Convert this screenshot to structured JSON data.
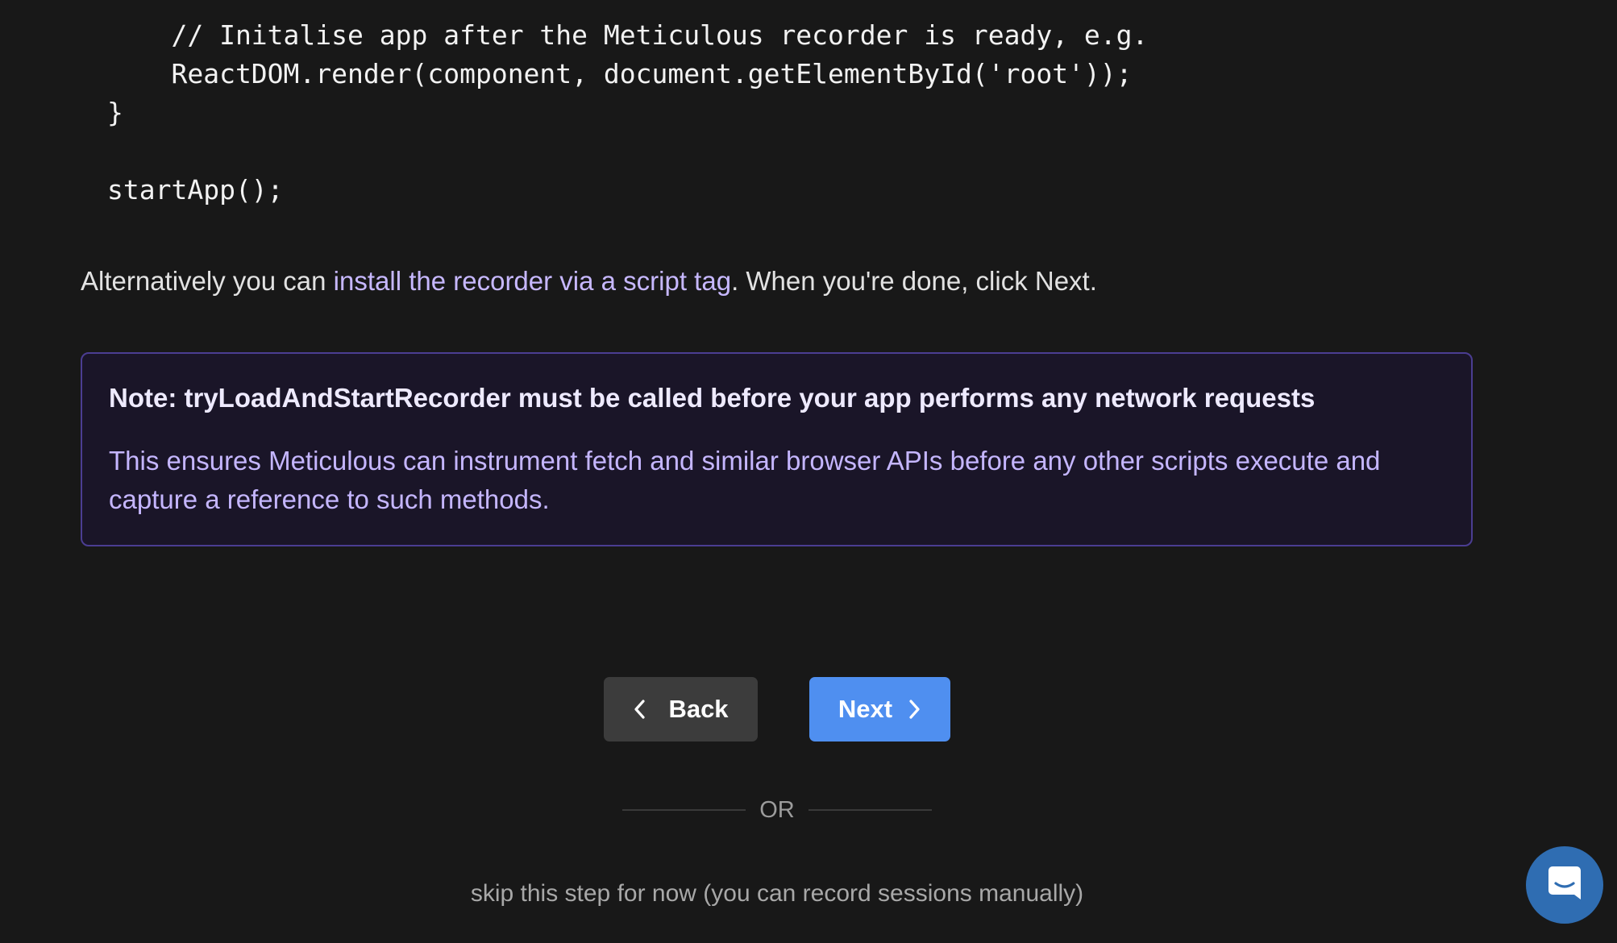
{
  "code": {
    "lines": [
      "    // Initalise app after the Meticulous recorder is ready, e.g.",
      "    ReactDOM.render(component, document.getElementById('root'));",
      "}",
      "",
      "startApp();"
    ]
  },
  "intro": {
    "prefix": "Alternatively you can ",
    "link": "install the recorder via a script tag",
    "suffix": ". When you're done, click Next."
  },
  "note": {
    "title": "Note: tryLoadAndStartRecorder must be called before your app performs any network requests",
    "body": "This ensures Meticulous can instrument fetch and similar browser APIs before any other scripts execute and capture a reference to such methods."
  },
  "buttons": {
    "back_label": "Back",
    "next_label": "Next"
  },
  "divider": {
    "label": "OR"
  },
  "skip": {
    "label": "skip this step for now (you can record sessions manually)"
  },
  "icons": {
    "back": "chevron-left-icon",
    "next": "chevron-right-icon",
    "chat": "chat-icon"
  },
  "colors": {
    "background": "#181818",
    "link": "#c7b8ff",
    "note_border": "#4b3d92",
    "note_background": "#1a1528",
    "next_button": "#4f8ff0",
    "back_button": "#3c3c3c",
    "chat_button": "#2f6db2"
  }
}
